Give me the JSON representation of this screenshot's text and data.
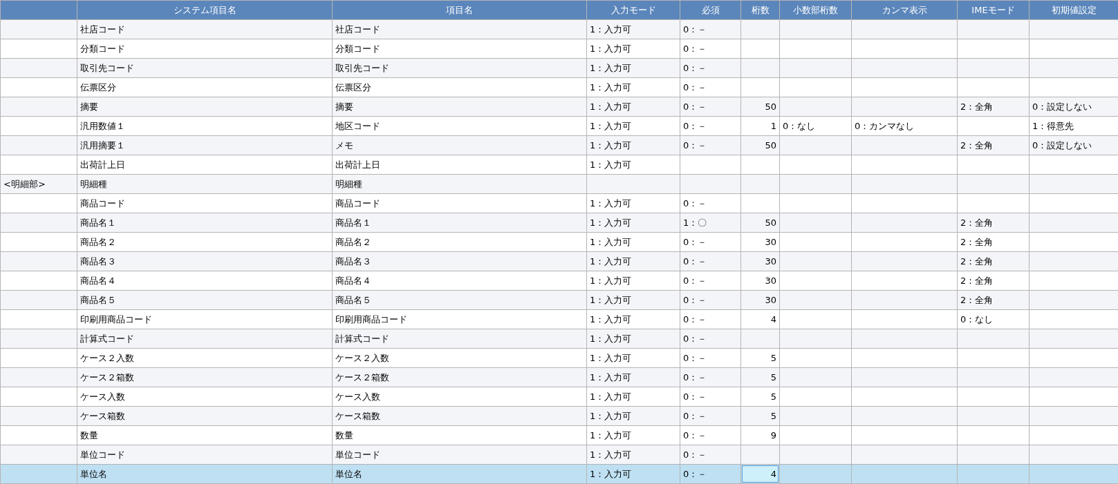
{
  "table": {
    "columns": [
      null,
      "システム項目名",
      "項目名",
      "入力モード",
      "必須",
      "桁数",
      "小数部桁数",
      "カンマ表示",
      "IMEモード",
      "初期値設定"
    ],
    "rows": [
      {
        "cells": [
          null,
          "社店コード",
          "社店コード",
          "1：入力可",
          "0：－",
          null,
          null,
          null,
          null,
          null
        ],
        "selected": false
      },
      {
        "cells": [
          null,
          "分類コード",
          "分類コード",
          "1：入力可",
          "0：－",
          null,
          null,
          null,
          null,
          null
        ],
        "selected": false
      },
      {
        "cells": [
          null,
          "取引先コード",
          "取引先コード",
          "1：入力可",
          "0：－",
          null,
          null,
          null,
          null,
          null
        ],
        "selected": false
      },
      {
        "cells": [
          null,
          "伝票区分",
          "伝票区分",
          "1：入力可",
          "0：－",
          null,
          null,
          null,
          null,
          null
        ],
        "selected": false
      },
      {
        "cells": [
          null,
          "摘要",
          "摘要",
          "1：入力可",
          "0：－",
          "50",
          null,
          null,
          "2：全角",
          "0：設定しない"
        ],
        "selected": false
      },
      {
        "cells": [
          null,
          "汎用数値１",
          "地区コード",
          "1：入力可",
          "0：－",
          "1",
          "0：なし",
          "0：カンマなし",
          null,
          "1：得意先"
        ],
        "selected": false
      },
      {
        "cells": [
          null,
          "汎用摘要１",
          "メモ",
          "1：入力可",
          "0：－",
          "50",
          null,
          null,
          "2：全角",
          "0：設定しない"
        ],
        "selected": false
      },
      {
        "cells": [
          null,
          "出荷計上日",
          "出荷計上日",
          "1：入力可",
          null,
          null,
          null,
          null,
          null,
          null
        ],
        "selected": false
      },
      {
        "cells": [
          "<明細部>",
          "明細種",
          "明細種",
          null,
          null,
          null,
          null,
          null,
          null,
          null
        ],
        "selected": false
      },
      {
        "cells": [
          null,
          "商品コード",
          "商品コード",
          "1：入力可",
          "0：－",
          null,
          null,
          null,
          null,
          null
        ],
        "selected": false
      },
      {
        "cells": [
          null,
          "商品名１",
          "商品名１",
          "1：入力可",
          "1：〇",
          "50",
          null,
          null,
          "2：全角",
          null
        ],
        "selected": false
      },
      {
        "cells": [
          null,
          "商品名２",
          "商品名２",
          "1：入力可",
          "0：－",
          "30",
          null,
          null,
          "2：全角",
          null
        ],
        "selected": false
      },
      {
        "cells": [
          null,
          "商品名３",
          "商品名３",
          "1：入力可",
          "0：－",
          "30",
          null,
          null,
          "2：全角",
          null
        ],
        "selected": false
      },
      {
        "cells": [
          null,
          "商品名４",
          "商品名４",
          "1：入力可",
          "0：－",
          "30",
          null,
          null,
          "2：全角",
          null
        ],
        "selected": false
      },
      {
        "cells": [
          null,
          "商品名５",
          "商品名５",
          "1：入力可",
          "0：－",
          "30",
          null,
          null,
          "2：全角",
          null
        ],
        "selected": false
      },
      {
        "cells": [
          null,
          "印刷用商品コード",
          "印刷用商品コード",
          "1：入力可",
          "0：－",
          "4",
          null,
          null,
          "0：なし",
          null
        ],
        "selected": false
      },
      {
        "cells": [
          null,
          "計算式コード",
          "計算式コード",
          "1：入力可",
          "0：－",
          null,
          null,
          null,
          null,
          null
        ],
        "selected": false
      },
      {
        "cells": [
          null,
          "ケース２入数",
          "ケース２入数",
          "1：入力可",
          "0：－",
          "5",
          null,
          null,
          null,
          null
        ],
        "selected": false
      },
      {
        "cells": [
          null,
          "ケース２箱数",
          "ケース２箱数",
          "1：入力可",
          "0：－",
          "5",
          null,
          null,
          null,
          null
        ],
        "selected": false
      },
      {
        "cells": [
          null,
          "ケース入数",
          "ケース入数",
          "1：入力可",
          "0：－",
          "5",
          null,
          null,
          null,
          null
        ],
        "selected": false
      },
      {
        "cells": [
          null,
          "ケース箱数",
          "ケース箱数",
          "1：入力可",
          "0：－",
          "5",
          null,
          null,
          null,
          null
        ],
        "selected": false
      },
      {
        "cells": [
          null,
          "数量",
          "数量",
          "1：入力可",
          "0：－",
          "9",
          null,
          null,
          null,
          null
        ],
        "selected": false
      },
      {
        "cells": [
          null,
          "単位コード",
          "単位コード",
          "1：入力可",
          "0：－",
          null,
          null,
          null,
          null,
          null
        ],
        "selected": false
      },
      {
        "cells": [
          null,
          "単位名",
          "単位名",
          "1：入力可",
          "0：－",
          {
            "kind": "input",
            "value": "4"
          },
          null,
          null,
          null,
          null
        ],
        "selected": true
      }
    ]
  }
}
